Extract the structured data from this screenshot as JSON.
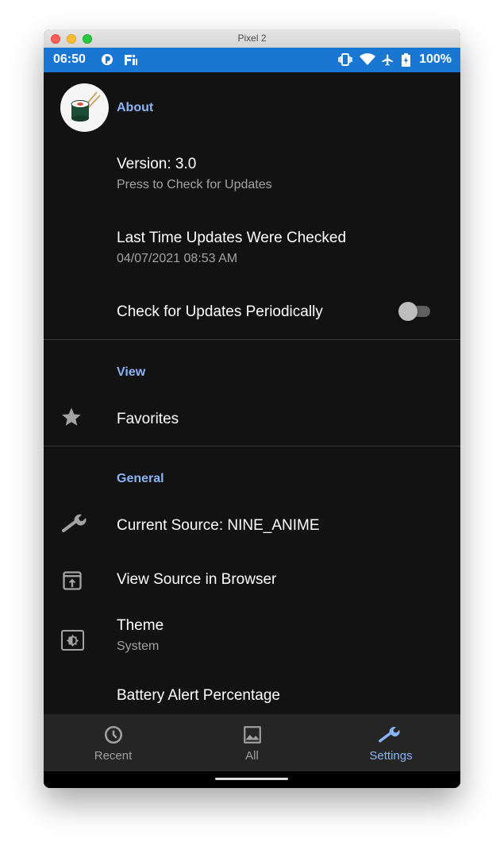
{
  "window": {
    "title": "Pixel 2"
  },
  "statusbar": {
    "time": "06:50",
    "battery": "100%"
  },
  "about": {
    "header": "About",
    "version_title": "Version: 3.0",
    "version_subtitle": "Press to Check for Updates",
    "last_check_title": "Last Time Updates Were Checked",
    "last_check_value": "04/07/2021 08:53 AM",
    "periodic_title": "Check for Updates Periodically",
    "periodic_enabled": false
  },
  "view": {
    "header": "View",
    "favorites": "Favorites"
  },
  "general": {
    "header": "General",
    "current_source": "Current Source: NINE_ANIME",
    "view_source": "View Source in Browser",
    "theme_title": "Theme",
    "theme_value": "System",
    "battery_alert": "Battery Alert Percentage"
  },
  "bottomnav": {
    "recent": "Recent",
    "all": "All",
    "settings": "Settings",
    "active": "settings"
  },
  "colors": {
    "accent": "#8ab4f8",
    "statusbar": "#1976d2",
    "background": "#121212"
  }
}
